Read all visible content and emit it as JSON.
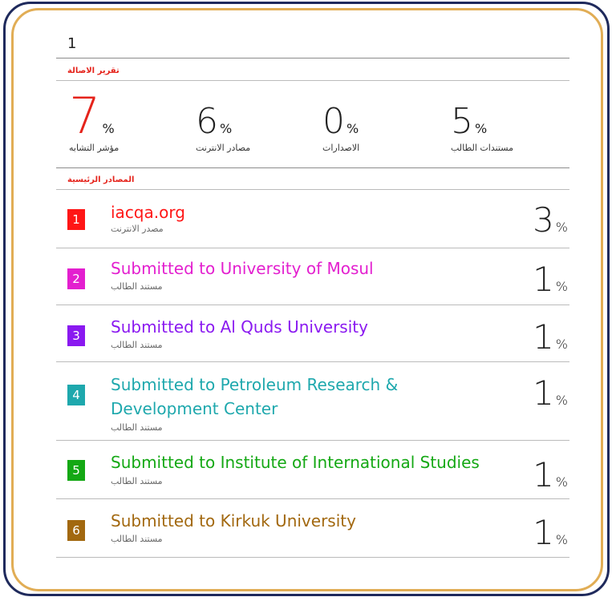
{
  "page_number": "1",
  "report_title": "تقرير الاصالة",
  "stats": [
    {
      "value": "7",
      "unit": "%",
      "label": "مؤشر التشابه"
    },
    {
      "value": "6",
      "unit": "%",
      "label": "مصادر الانترنت"
    },
    {
      "value": "0",
      "unit": "%",
      "label": "الاصدارات"
    },
    {
      "value": "5",
      "unit": "%",
      "label": "مستندات الطالب"
    }
  ],
  "sources_title": "المصادر الرئيسية",
  "sources": [
    {
      "index": "1",
      "title": "iacqa.org",
      "type": "مصدر الانترنت",
      "percent": "3",
      "unit": "%",
      "color": "#ff1616"
    },
    {
      "index": "2",
      "title": "Submitted to University of Mosul",
      "type": "مستند الطالب",
      "percent": "1",
      "unit": "%",
      "color": "#e31fcf"
    },
    {
      "index": "3",
      "title": "Submitted to Al Quds University",
      "type": "مستند الطالب",
      "percent": "1",
      "unit": "%",
      "color": "#8a19f0"
    },
    {
      "index": "4",
      "title": "Submitted to Petroleum Research & Development Center",
      "type": "مستند الطالب",
      "percent": "1",
      "unit": "%",
      "color": "#1ea8ad"
    },
    {
      "index": "5",
      "title": "Submitted to Institute of International Studies",
      "type": "مستند الطالب",
      "percent": "1",
      "unit": "%",
      "color": "#14a814"
    },
    {
      "index": "6",
      "title": "Submitted to Kirkuk University",
      "type": "مستند الطالب",
      "percent": "1",
      "unit": "%",
      "color": "#a2680f"
    }
  ]
}
